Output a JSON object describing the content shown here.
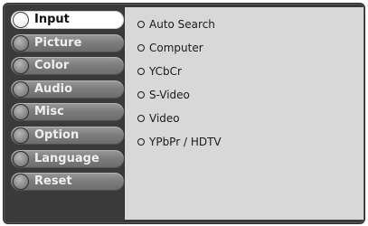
{
  "menu": {
    "items": [
      {
        "label": "Input",
        "selected": true
      },
      {
        "label": "Picture",
        "selected": false
      },
      {
        "label": "Color",
        "selected": false
      },
      {
        "label": "Audio",
        "selected": false
      },
      {
        "label": "Misc",
        "selected": false
      },
      {
        "label": "Option",
        "selected": false
      },
      {
        "label": "Language",
        "selected": false
      },
      {
        "label": "Reset",
        "selected": false
      }
    ]
  },
  "input_options": [
    {
      "label": "Auto Search"
    },
    {
      "label": "Computer"
    },
    {
      "label": "YCbCr"
    },
    {
      "label": "S-Video"
    },
    {
      "label": "Video"
    },
    {
      "label": "YPbPr / HDTV"
    }
  ],
  "colors": {
    "menu_bg": "#3a3a3a",
    "item_bg": "#808080",
    "selected_bg": "#ffffff",
    "content_bg": "#d8d8d8"
  }
}
